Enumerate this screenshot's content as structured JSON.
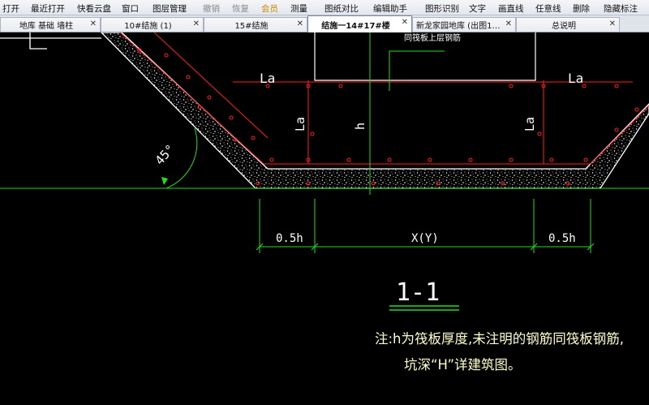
{
  "menu": {
    "items": [
      {
        "label": "打开",
        "style": "normal"
      },
      {
        "label": "最近打开",
        "style": "normal"
      },
      {
        "label": "快看云盘",
        "style": "normal"
      },
      {
        "label": "窗口",
        "style": "normal"
      },
      {
        "label": "图层管理",
        "style": "normal"
      },
      {
        "label": "撤销",
        "style": "dim"
      },
      {
        "label": "恢复",
        "style": "dim"
      },
      {
        "label": "会员",
        "style": "gold"
      },
      {
        "label": "测量",
        "style": "normal"
      },
      {
        "label": "图纸对比",
        "style": "normal"
      },
      {
        "label": "编辑助手",
        "style": "normal"
      },
      {
        "label": "图形识别",
        "style": "normal"
      },
      {
        "label": "文字",
        "style": "normal"
      },
      {
        "label": "画直线",
        "style": "normal"
      },
      {
        "label": "任意线",
        "style": "normal"
      },
      {
        "label": "删除",
        "style": "normal"
      },
      {
        "label": "隐藏标注",
        "style": "normal"
      }
    ]
  },
  "tabs": [
    {
      "label": "地库 基础 墙柱",
      "active": false,
      "close": "✕"
    },
    {
      "label": "10#结施 (1)",
      "active": false,
      "close": "✕"
    },
    {
      "label": "15#结施",
      "active": false,
      "close": "✕"
    },
    {
      "label": "结施一14#17#楼",
      "active": true,
      "close": "✕"
    },
    {
      "label": "新龙家园地库 (出图12…",
      "active": false,
      "close": "✕"
    },
    {
      "label": "总说明",
      "active": false,
      "close": "✕"
    }
  ],
  "drawing": {
    "label_la_left": "La",
    "label_la_right": "La",
    "label_la_vert_left": "La",
    "label_la_vert_right": "La",
    "label_h": "h",
    "label_angle": "45°",
    "label_rebar_note": "同筏板上层钢筋",
    "dim_left": "0.5h",
    "dim_center": "X(Y)",
    "dim_right": "0.5h",
    "section_title": "1-1",
    "note_line1": "注:h为筏板厚度,未注明的钢筋同筏板钢筋,",
    "note_line2": "坑深“H”详建筑图。",
    "colors": {
      "concrete": "#ffffff",
      "rebar": "#ff2020",
      "dimension": "#22dd22",
      "text_white": "#ffffff",
      "text_yellow": "#ffff66"
    }
  }
}
